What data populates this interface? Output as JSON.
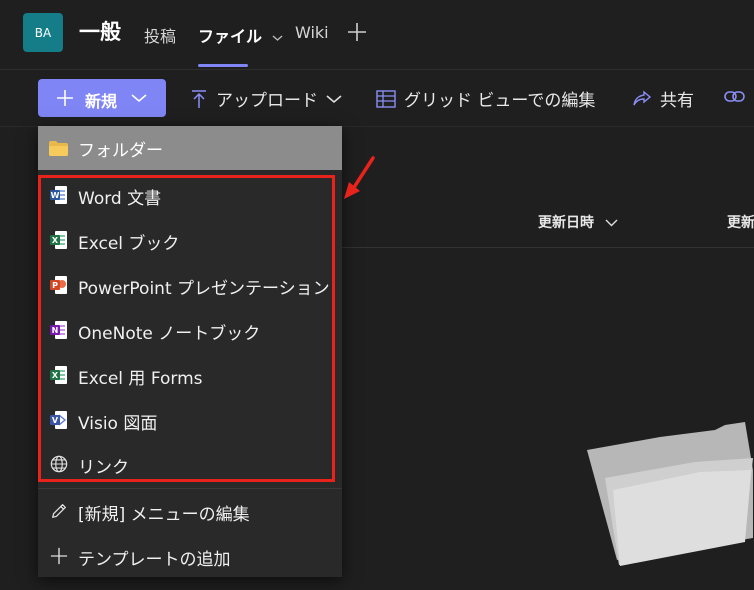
{
  "header": {
    "avatar_initials": "BA",
    "channel_name": "一般",
    "tabs": [
      {
        "label": "投稿"
      },
      {
        "label": "ファイル"
      },
      {
        "label": "Wiki"
      }
    ]
  },
  "toolbar": {
    "new_label": "新規",
    "upload_label": "アップロード",
    "grid_label": "グリッド ビューでの編集",
    "share_label": "共有"
  },
  "columns": {
    "modified": "更新日時",
    "modified_by": "更新"
  },
  "menu": {
    "folder": "フォルダー",
    "items": [
      {
        "label": "Word 文書",
        "icon": "word-icon",
        "color": "#2b579a",
        "letter": "W"
      },
      {
        "label": "Excel ブック",
        "icon": "excel-icon",
        "color": "#217346",
        "letter": "X"
      },
      {
        "label": "PowerPoint プレゼンテーション",
        "icon": "powerpoint-icon",
        "color": "#d24726",
        "letter": "P"
      },
      {
        "label": "OneNote ノートブック",
        "icon": "onenote-icon",
        "color": "#7719aa",
        "letter": "N"
      },
      {
        "label": "Excel 用 Forms",
        "icon": "excel-forms-icon",
        "color": "#217346",
        "letter": "X"
      },
      {
        "label": "Visio 図面",
        "icon": "visio-icon",
        "color": "#3955a3",
        "letter": "V"
      },
      {
        "label": "リンク",
        "icon": "globe-icon"
      }
    ],
    "edit_label": "[新規] メニューの編集",
    "template_label": "テンプレートの追加"
  },
  "colors": {
    "accent": "#7f85f5",
    "highlight_border": "#e8231b"
  }
}
